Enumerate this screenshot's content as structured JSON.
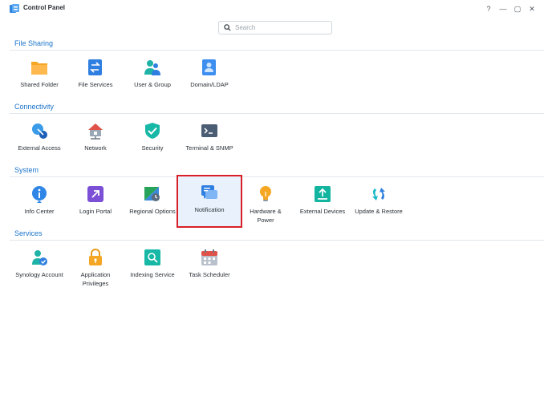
{
  "window": {
    "title": "Control Panel",
    "help_label": "?",
    "minimize_label": "—",
    "maximize_label": "▢",
    "close_label": "✕"
  },
  "search": {
    "placeholder": "Search",
    "value": ""
  },
  "sections": {
    "file_sharing": {
      "title": "File Sharing",
      "items": [
        {
          "label": "Shared Folder",
          "icon": "folder-icon"
        },
        {
          "label": "File Services",
          "icon": "file-services-icon"
        },
        {
          "label": "User & Group",
          "icon": "user-group-icon"
        },
        {
          "label": "Domain/LDAP",
          "icon": "domain-ldap-icon"
        }
      ]
    },
    "connectivity": {
      "title": "Connectivity",
      "items": [
        {
          "label": "External Access",
          "icon": "external-access-icon"
        },
        {
          "label": "Network",
          "icon": "network-icon"
        },
        {
          "label": "Security",
          "icon": "shield-check-icon"
        },
        {
          "label": "Terminal & SNMP",
          "icon": "terminal-icon"
        }
      ]
    },
    "system": {
      "title": "System",
      "items": [
        {
          "label": "Info Center",
          "icon": "info-icon"
        },
        {
          "label": "Login Portal",
          "icon": "login-portal-icon"
        },
        {
          "label": "Regional Options",
          "icon": "regional-options-icon"
        },
        {
          "label": "Notification",
          "icon": "notification-icon",
          "selected": true
        },
        {
          "label": "Hardware & Power",
          "icon": "lightbulb-icon"
        },
        {
          "label": "External Devices",
          "icon": "external-devices-icon"
        },
        {
          "label": "Update & Restore",
          "icon": "update-restore-icon"
        }
      ]
    },
    "services": {
      "title": "Services",
      "items": [
        {
          "label": "Synology Account",
          "icon": "synology-account-icon"
        },
        {
          "label": "Application Privileges",
          "icon": "lock-icon"
        },
        {
          "label": "Indexing Service",
          "icon": "indexing-search-icon"
        },
        {
          "label": "Task Scheduler",
          "icon": "calendar-icon"
        }
      ]
    }
  },
  "colors": {
    "section_title": "#1a73c9",
    "selection_border": "#d81f26",
    "selection_bg": "#e9f2fc"
  }
}
